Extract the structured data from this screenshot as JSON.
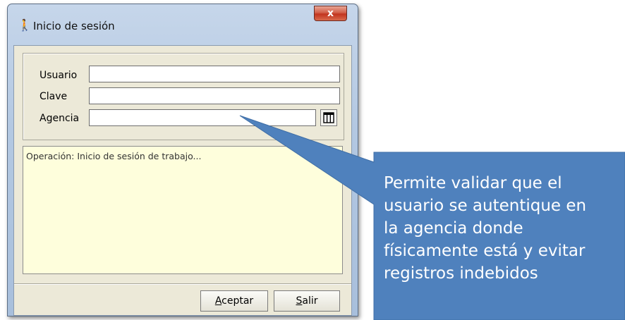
{
  "window": {
    "title": "Inicio de sesión",
    "close_label": "x"
  },
  "form": {
    "usuario_label": "Usuario",
    "usuario_value": "",
    "clave_label": "Clave",
    "clave_value": "",
    "agencia_label": "Agencia",
    "agencia_value": ""
  },
  "log": {
    "text": "Operación: Inicio de sesión de trabajo..."
  },
  "buttons": {
    "aceptar_accel": "A",
    "aceptar_rest": "ceptar",
    "salir_accel": "S",
    "salir_rest": "alir"
  },
  "callout": {
    "text": "Permite validar que el\nusuario se autentique en\nla agencia donde\nfísicamente está y evitar\nregistros indebidos",
    "color": "#4f81bd"
  },
  "icons": {
    "app": "walking-person-icon",
    "lookup": "grid-table-icon"
  }
}
